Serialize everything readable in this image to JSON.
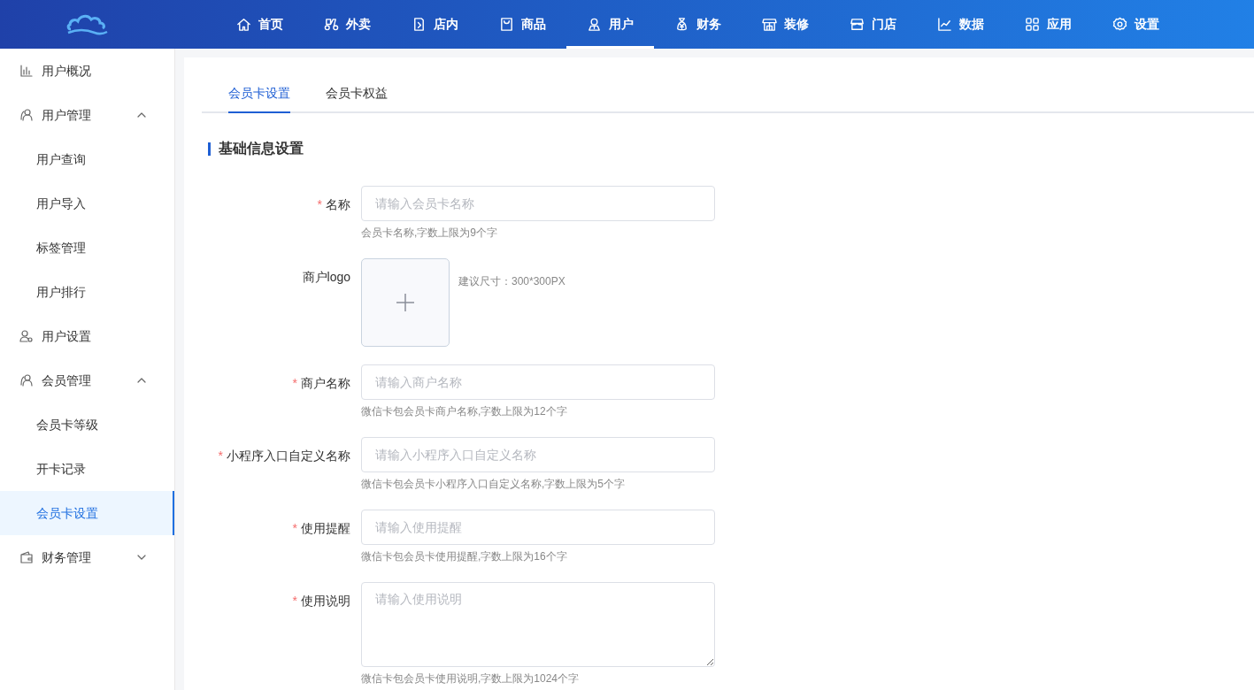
{
  "topnav": [
    {
      "label": "首页",
      "selected": false
    },
    {
      "label": "外卖",
      "selected": false
    },
    {
      "label": "店内",
      "selected": false
    },
    {
      "label": "商品",
      "selected": false
    },
    {
      "label": "用户",
      "selected": true
    },
    {
      "label": "财务",
      "selected": false
    },
    {
      "label": "装修",
      "selected": false
    },
    {
      "label": "门店",
      "selected": false
    },
    {
      "label": "数据",
      "selected": false
    },
    {
      "label": "应用",
      "selected": false
    },
    {
      "label": "设置",
      "selected": false
    }
  ],
  "sidebar": {
    "items": [
      {
        "label": "用户概况",
        "selected": false
      },
      {
        "label": "用户管理",
        "expanded": true,
        "children": [
          {
            "label": "用户查询",
            "selected": false
          },
          {
            "label": "用户导入",
            "selected": false
          },
          {
            "label": "标签管理",
            "selected": false
          },
          {
            "label": "用户排行",
            "selected": false
          }
        ]
      },
      {
        "label": "用户设置",
        "selected": false
      },
      {
        "label": "会员管理",
        "expanded": true,
        "children": [
          {
            "label": "会员卡等级",
            "selected": false
          },
          {
            "label": "开卡记录",
            "selected": false
          },
          {
            "label": "会员卡设置",
            "selected": true
          }
        ]
      },
      {
        "label": "财务管理",
        "expanded": false
      }
    ]
  },
  "tabs": [
    {
      "label": "会员卡设置",
      "selected": true
    },
    {
      "label": "会员卡权益",
      "selected": false
    }
  ],
  "section_title": "基础信息设置",
  "form": [
    {
      "kind": "input",
      "label": "名称",
      "required_mark": "*",
      "placeholder": "请输入会员卡名称",
      "hint": "会员卡名称,字数上限为9个字"
    },
    {
      "kind": "upload",
      "label": "商户logo",
      "hint": "建议尺寸：300*300PX"
    },
    {
      "kind": "input",
      "label": "商户名称",
      "required_mark": "*",
      "placeholder": "请输入商户名称",
      "hint": "微信卡包会员卡商户名称,字数上限为12个字"
    },
    {
      "kind": "input",
      "label": "小程序入口自定义名称",
      "required_mark": "*",
      "placeholder": "请输入小程序入口自定义名称",
      "hint": "微信卡包会员卡小程序入口自定义名称,字数上限为5个字"
    },
    {
      "kind": "input",
      "label": "使用提醒",
      "required_mark": "*",
      "placeholder": "请输入使用提醒",
      "hint": "微信卡包会员卡使用提醒,字数上限为16个字"
    },
    {
      "kind": "textarea",
      "label": "使用说明",
      "required_mark": "*",
      "placeholder": "请输入使用说明",
      "hint": "微信卡包会员卡使用说明,字数上限为1024个字"
    }
  ]
}
